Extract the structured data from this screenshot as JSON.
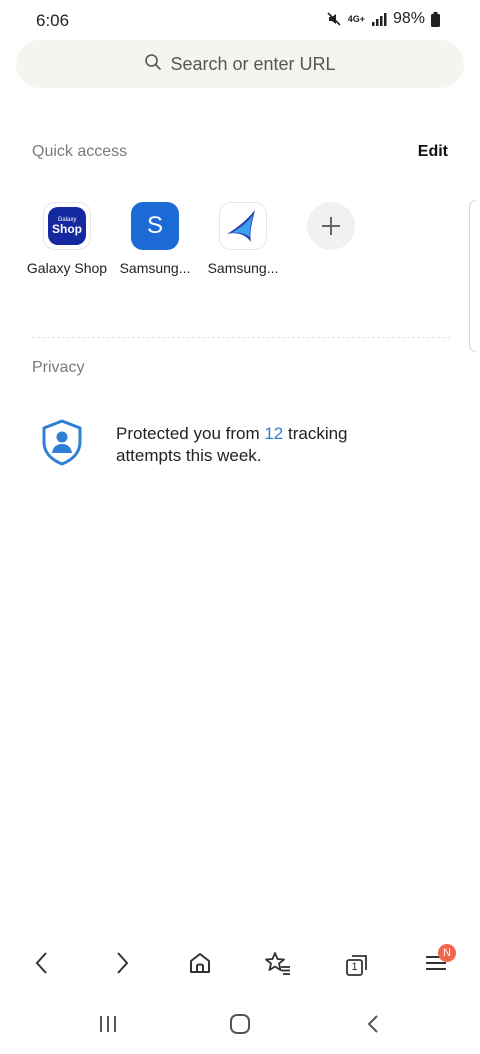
{
  "status_bar": {
    "time": "6:06",
    "network": "4G+",
    "battery": "98%"
  },
  "search": {
    "placeholder": "Search or enter URL",
    "icon": "search-icon"
  },
  "quick_access": {
    "title": "Quick access",
    "edit_label": "Edit",
    "items": [
      {
        "label": "Galaxy Shop",
        "icon": "galaxy-shop-icon",
        "icon_text_small": "Galaxy",
        "icon_text_big": "Shop"
      },
      {
        "label": "Samsung...",
        "icon": "samsung-s-icon",
        "icon_text": "S"
      },
      {
        "label": "Samsung...",
        "icon": "samsung-browser-icon"
      },
      {
        "label": "",
        "icon": "add-icon"
      }
    ]
  },
  "privacy": {
    "title": "Privacy",
    "text_before": "Protected you from ",
    "count": "12",
    "text_after": " tracking attempts this week.",
    "icon": "shield-user-icon"
  },
  "bottom_nav": {
    "badge": "N",
    "items": [
      "back-icon",
      "forward-icon",
      "home-icon",
      "bookmarks-icon",
      "tabs-icon",
      "menu-icon"
    ],
    "tabs_count": "1"
  },
  "colors": {
    "accent": "#2f7fd6",
    "badge": "#f2664c",
    "search_bg": "#f4f5f0",
    "samsung_blue": "#1b6ad6",
    "galaxy_shop_blue": "#1428a0"
  }
}
